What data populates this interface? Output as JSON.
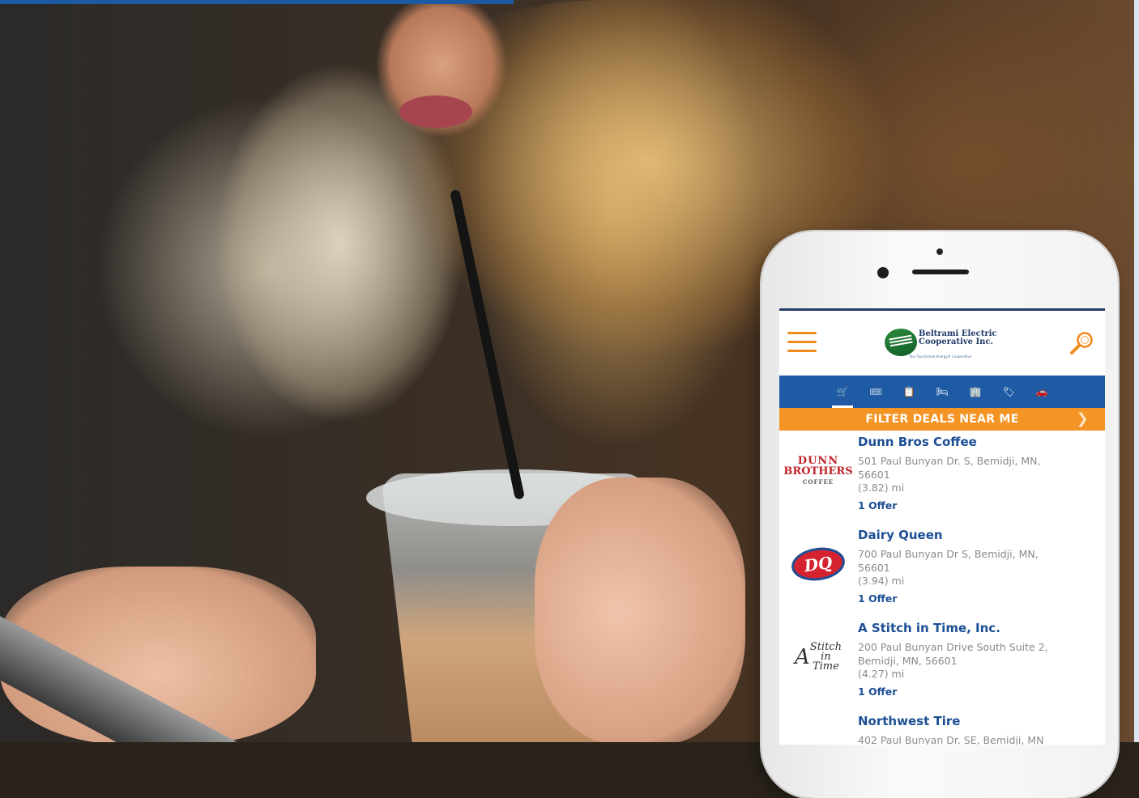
{
  "app": {
    "logo_name_line1": "Beltrami Electric",
    "logo_name_line2": "Cooperative Inc.",
    "logo_tagline": "Your Touchstone Energy® Cooperative",
    "filter_label": "FILTER DEALS NEAR ME"
  },
  "categories": [
    {
      "icon": "cart-icon",
      "glyph": "🛒",
      "active": true
    },
    {
      "icon": "ticket-icon",
      "glyph": "🎟"
    },
    {
      "icon": "clipboard-icon",
      "glyph": "📋"
    },
    {
      "icon": "bed-icon",
      "glyph": "🛏"
    },
    {
      "icon": "building-icon",
      "glyph": "🏢"
    },
    {
      "icon": "tag-icon",
      "glyph": "🏷"
    },
    {
      "icon": "car-icon",
      "glyph": "🚗"
    }
  ],
  "listings": [
    {
      "name": "Dunn Bros Coffee",
      "address": "501 Paul Bunyan Dr. S, Bemidji, MN, 56601",
      "distance": "(3.82) mi",
      "offers": "1 Offer",
      "logo": {
        "line1": "DUNN",
        "line2": "BROTHERS",
        "line3": "COFFEE"
      }
    },
    {
      "name": "Dairy Queen",
      "address": "700 Paul Bunyan Dr S, Bemidji, MN, 56601",
      "distance": "(3.94) mi",
      "offers": "1 Offer",
      "logo": {
        "text": "DQ"
      }
    },
    {
      "name": "A Stitch in Time, Inc.",
      "address": "200 Paul Bunyan Drive South Suite 2, Bemidji, MN, 56601",
      "distance": "(4.27) mi",
      "offers": "1 Offer",
      "logo": {
        "a": "A",
        "line1": "Stitch",
        "line2": "in",
        "line3": "Time"
      }
    },
    {
      "name": "Northwest Tire",
      "address": "402 Paul Bunyan Dr. SE, Bemidji, MN"
    }
  ],
  "colors": {
    "brand_blue": "#1f5aa5",
    "accent_orange": "#f39424",
    "link_blue": "#1c4f95",
    "top_bar_blue": "#1c5aa3"
  }
}
